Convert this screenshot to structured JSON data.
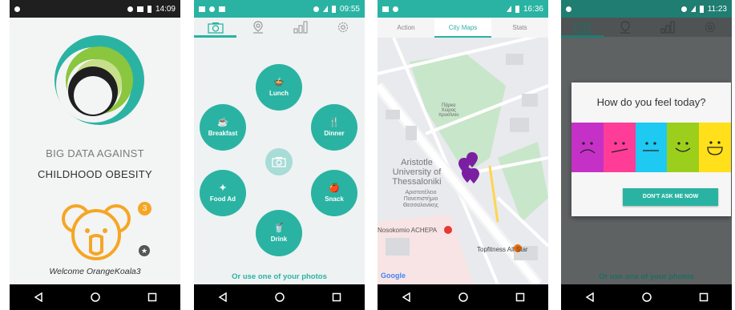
{
  "colors": {
    "teal": "#2ab3a3",
    "orange": "#f5a623",
    "dark_nav": "#000000"
  },
  "screen1": {
    "status_time": "14:09",
    "title_line1": "BIG DATA AGAINST",
    "title_line2": "CHILDHOOD OBESITY",
    "badge_count": "3",
    "welcome": "Welcome OrangeKoala3",
    "icons": [
      "logo-rings",
      "koala-avatar",
      "star-badge"
    ]
  },
  "screen2": {
    "status_time": "09:55",
    "tabs": [
      "camera-icon",
      "map-pin-icon",
      "stats-icon",
      "gear-icon"
    ],
    "meals": [
      {
        "label": "Lunch",
        "icon": "lunch-icon"
      },
      {
        "label": "Breakfast",
        "icon": "breakfast-icon"
      },
      {
        "label": "Dinner",
        "icon": "dinner-icon"
      },
      {
        "label": "Food Ad",
        "icon": "food-ad-icon"
      },
      {
        "label": "Snack",
        "icon": "snack-icon"
      },
      {
        "label": "Drink",
        "icon": "drink-icon"
      }
    ],
    "use_photos": "Or use one of your photos"
  },
  "screen3": {
    "status_time": "16:36",
    "tabs": [
      "Action",
      "City Maps",
      "Stats"
    ],
    "active_tab": "City Maps",
    "map_labels": {
      "park_line1": "Πάρκο",
      "park_line2": "Χώρος",
      "park_line3": "προσίνου",
      "uni_line1": "Aristotle",
      "uni_line2": "University of",
      "uni_line3": "Thessaloniki",
      "uni_gr1": "Αριστοτέλειο",
      "uni_gr2": "Πανεπιστήμιο",
      "uni_gr3": "Θεσσαλονίκης",
      "hospital": "Nosokomio ACHEPA",
      "gym": "Topfitness All Star",
      "google": "Google"
    }
  },
  "screen4": {
    "status_time": "11:23",
    "dialog_title": "How do you feel today?",
    "moods": [
      {
        "name": "very-sad",
        "color": "#c531c7"
      },
      {
        "name": "sad",
        "color": "#ff3d98"
      },
      {
        "name": "neutral",
        "color": "#1ec9f2"
      },
      {
        "name": "happy",
        "color": "#9ccf1c"
      },
      {
        "name": "very-happy",
        "color": "#ffe01a"
      }
    ],
    "dont_ask": "DON'T ASK ME NOW",
    "use_photos": "Or use one of your photos"
  }
}
